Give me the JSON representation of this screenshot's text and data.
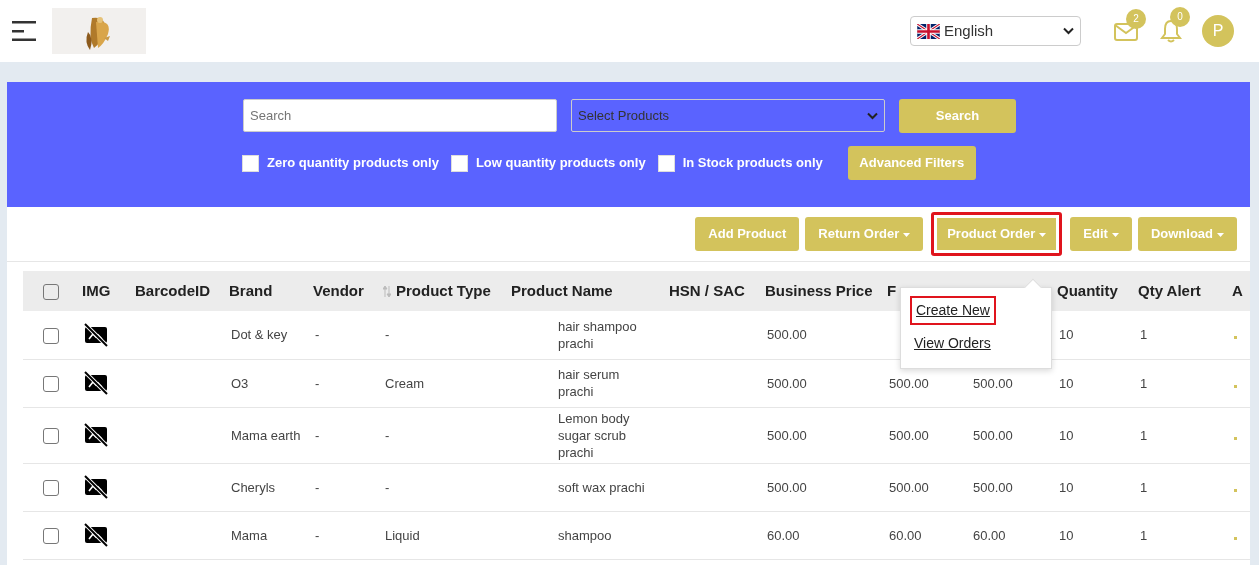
{
  "header": {
    "language": "English",
    "mail_count": "2",
    "notification_count": "0",
    "avatar_initial": "P"
  },
  "filters": {
    "search": {
      "placeholder": "Search"
    },
    "product_select": "Select Products",
    "search_button": "Search",
    "checkboxes": [
      {
        "label": "Zero quantity products only",
        "checked": false
      },
      {
        "label": "Low quantity products only",
        "checked": false
      },
      {
        "label": "In Stock products only",
        "checked": false
      }
    ],
    "advanced_button": "Advanced Filters"
  },
  "toolbar": [
    {
      "label": "Add Product",
      "caret": false,
      "highlighted": false
    },
    {
      "label": "Return Order",
      "caret": true,
      "highlighted": false
    },
    {
      "label": "Product Order",
      "caret": true,
      "highlighted": true
    },
    {
      "label": "Edit",
      "caret": true,
      "highlighted": false
    },
    {
      "label": "Download",
      "caret": true,
      "highlighted": false
    }
  ],
  "dropdown": {
    "items": [
      {
        "label": "Create New",
        "highlighted": true
      },
      {
        "label": "View Orders",
        "highlighted": false
      }
    ]
  },
  "table": {
    "select_all_checked": false,
    "columns": [
      {
        "label": "IMG",
        "sortable": false
      },
      {
        "label": "BarcodeID",
        "sortable": false
      },
      {
        "label": "Brand",
        "sortable": false
      },
      {
        "label": "Vendor",
        "sortable": false
      },
      {
        "label": "Product Type",
        "sortable": true
      },
      {
        "label": "Product Name",
        "sortable": false
      },
      {
        "label": "HSN / SAC",
        "sortable": false
      },
      {
        "label": "Business Price",
        "sortable": false
      },
      {
        "label": "F",
        "sortable": false
      },
      {},
      {
        "label": "Quantity",
        "sortable": false
      },
      {
        "label": "Qty Alert",
        "sortable": false
      },
      {
        "label": "A",
        "sortable": false
      }
    ],
    "rows": [
      {
        "checked": false,
        "cells": [
          "",
          "",
          "Dot & key",
          "-",
          "-",
          "hair shampoo prachi",
          "",
          "500.00",
          "",
          "",
          "10",
          "1"
        ]
      },
      {
        "checked": false,
        "cells": [
          "",
          "",
          "O3",
          "-",
          "Cream",
          "hair serum prachi",
          "",
          "500.00",
          "500.00",
          "500.00",
          "10",
          "1"
        ]
      },
      {
        "checked": false,
        "cells": [
          "",
          "",
          "Mama earth",
          "-",
          "-",
          "Lemon body sugar scrub prachi",
          "",
          "500.00",
          "500.00",
          "500.00",
          "10",
          "1"
        ]
      },
      {
        "checked": false,
        "cells": [
          "",
          "",
          "Cheryls",
          "-",
          "-",
          "soft wax prachi",
          "",
          "500.00",
          "500.00",
          "500.00",
          "10",
          "1"
        ]
      },
      {
        "checked": false,
        "cells": [
          "",
          "",
          "Mama",
          "-",
          "Liquid",
          "shampoo",
          "",
          "60.00",
          "60.00",
          "60.00",
          "10",
          "1"
        ]
      }
    ]
  }
}
